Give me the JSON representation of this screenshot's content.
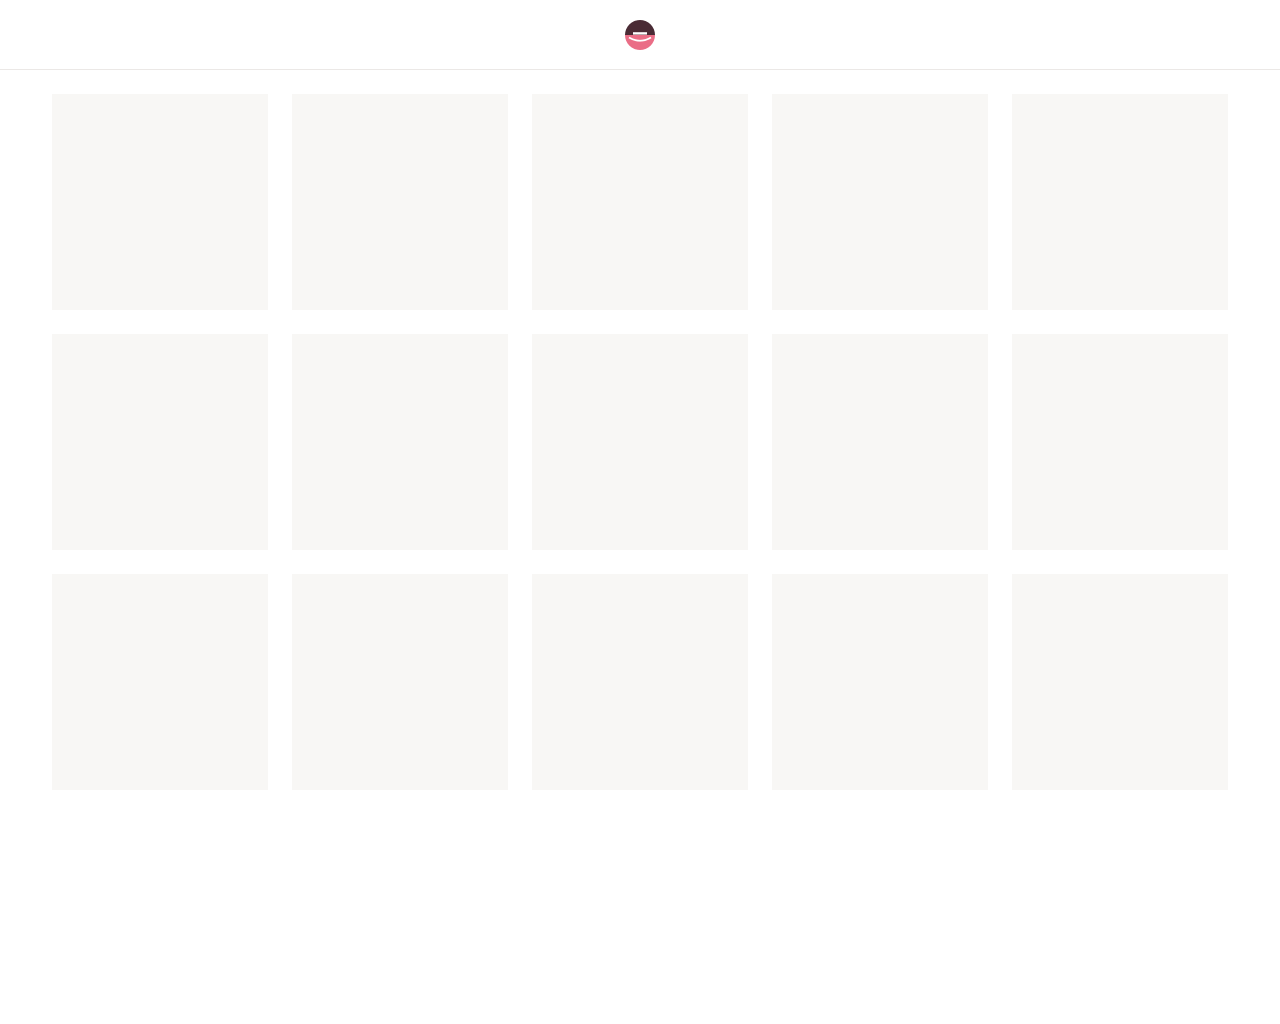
{
  "header": {
    "logo_icon": "etsy-style-e-logo-icon",
    "logo_colors": {
      "top": "#4a2b35",
      "bottom": "#ea6d86",
      "stroke": "#ffffff"
    }
  },
  "grid": {
    "tile_color": "#f8f7f5",
    "tiles": [
      {
        "state": "loading-placeholder"
      },
      {
        "state": "loading-placeholder"
      },
      {
        "state": "loading-placeholder"
      },
      {
        "state": "loading-placeholder"
      },
      {
        "state": "loading-placeholder"
      },
      {
        "state": "loading-placeholder"
      },
      {
        "state": "loading-placeholder"
      },
      {
        "state": "loading-placeholder"
      },
      {
        "state": "loading-placeholder"
      },
      {
        "state": "loading-placeholder"
      },
      {
        "state": "loading-placeholder"
      },
      {
        "state": "loading-placeholder"
      },
      {
        "state": "loading-placeholder"
      },
      {
        "state": "loading-placeholder"
      },
      {
        "state": "loading-placeholder"
      }
    ]
  }
}
